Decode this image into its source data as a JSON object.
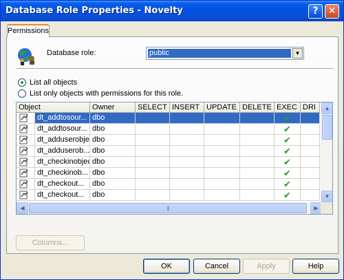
{
  "window": {
    "title": "Database Role Properties - Novelty",
    "help_glyph": "?",
    "close_glyph": "✕"
  },
  "tabs": [
    {
      "label": "Permissions"
    }
  ],
  "role": {
    "label": "Database role:",
    "value": "public"
  },
  "radios": [
    {
      "label": "List all objects",
      "checked": true
    },
    {
      "label": "List only objects with permissions for this role.",
      "checked": false
    }
  ],
  "grid": {
    "columns": [
      "Object",
      "Owner",
      "SELECT",
      "INSERT",
      "UPDATE",
      "DELETE",
      "EXEC",
      "DRI"
    ],
    "rows": [
      {
        "name": "dt_addtosour...",
        "owner": "dbo",
        "exec": true,
        "selected": true
      },
      {
        "name": "dt_addtosour...",
        "owner": "dbo",
        "exec": true
      },
      {
        "name": "dt_adduserobject",
        "owner": "dbo",
        "exec": true
      },
      {
        "name": "dt_adduserob...",
        "owner": "dbo",
        "exec": true
      },
      {
        "name": "dt_checkinobject",
        "owner": "dbo",
        "exec": true
      },
      {
        "name": "dt_checkinob...",
        "owner": "dbo",
        "exec": true
      },
      {
        "name": "dt_checkout...",
        "owner": "dbo",
        "exec": true
      },
      {
        "name": "dt_checkout...",
        "owner": "dbo",
        "exec": true
      }
    ]
  },
  "buttons": {
    "columns": "Columns...",
    "ok": "OK",
    "cancel": "Cancel",
    "apply": "Apply",
    "help": "Help"
  },
  "colors": {
    "titlebar": "#0054e3",
    "selection": "#316ac5",
    "check": "#21a121"
  }
}
